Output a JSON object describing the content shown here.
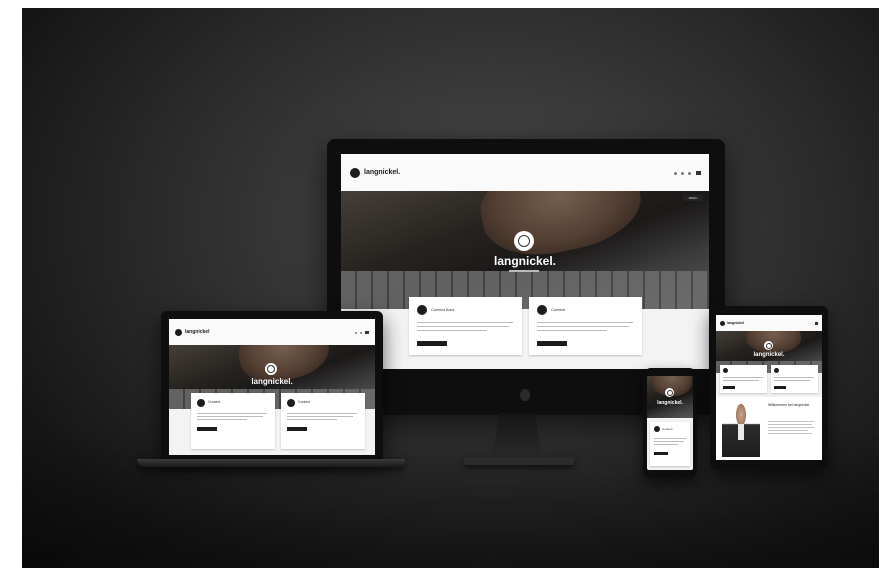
{
  "brand": {
    "name": "langnickel",
    "tagline": "",
    "accent": "#1c1c1c"
  },
  "desktop": {
    "nav_logo": "langnickel.",
    "hero_title": "langnickel.",
    "menu_button": "MENU",
    "cards": [
      {
        "title": "Content Area",
        "icon": "circle-icon"
      },
      {
        "title": "Content",
        "icon": "circle-icon"
      }
    ]
  },
  "laptop": {
    "nav_logo": "langnickel",
    "hero_title": "langnickel.",
    "cards": [
      {
        "title": "Content",
        "icon": "circle-icon"
      },
      {
        "title": "Content",
        "icon": "circle-icon"
      }
    ]
  },
  "tablet": {
    "nav_logo": "langnickel",
    "hero_title": "langnickel.",
    "profile_heading": "Willkommen bei langnickel"
  },
  "phone": {
    "hero_title": "langnickel.",
    "card_title": "Content"
  },
  "colors": {
    "background_center": "#4a4a4a",
    "background_edge": "#0d0d0d",
    "device_frame": "#111111"
  }
}
